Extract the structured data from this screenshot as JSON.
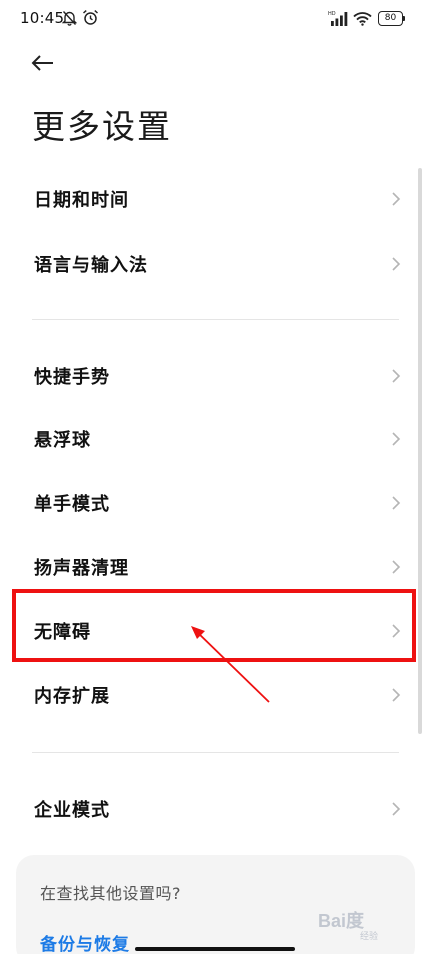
{
  "status_bar": {
    "time": "10:45",
    "battery_level": "80",
    "icons": [
      "mute-notification-icon",
      "alarm-icon",
      "hd-signal-icon",
      "wifi-icon",
      "battery-icon"
    ]
  },
  "header": {
    "back_icon": "arrow-left-icon",
    "title": "更多设置"
  },
  "settings_groups": [
    {
      "items": [
        {
          "label": "日期和时间"
        },
        {
          "label": "语言与输入法"
        }
      ]
    },
    {
      "items": [
        {
          "label": "快捷手势"
        },
        {
          "label": "悬浮球"
        },
        {
          "label": "单手模式"
        },
        {
          "label": "扬声器清理"
        },
        {
          "label": "无障碍"
        },
        {
          "label": "内存扩展"
        }
      ]
    },
    {
      "items": [
        {
          "label": "企业模式"
        }
      ]
    }
  ],
  "search_card": {
    "prompt": "在查找其他设置吗?",
    "link": "备份与恢复"
  },
  "watermark": {
    "text": "Bai度",
    "sub": "经验"
  },
  "annotation": {
    "highlight_color": "#ee1111",
    "highlighted_item": "无障碍"
  },
  "colors": {
    "accent": "#1d7be6",
    "divider": "#e5e5e5",
    "card_bg": "#f4f4f4"
  }
}
